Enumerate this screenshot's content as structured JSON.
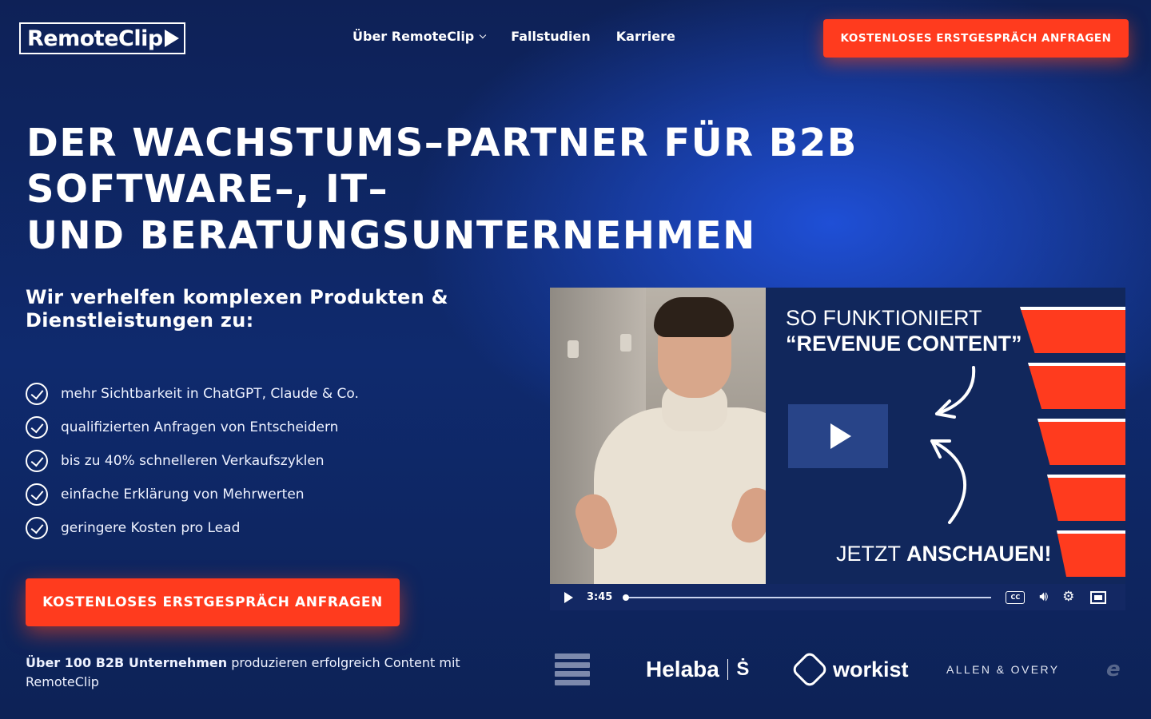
{
  "nav": {
    "logo_text": "RemoteClip",
    "links": [
      {
        "label": "Über RemoteClip",
        "has_dropdown": true
      },
      {
        "label": "Fallstudien"
      },
      {
        "label": "Karriere"
      }
    ],
    "cta_label": "KOSTENLOSES ERSTGESPRÄCH ANFRAGEN"
  },
  "hero": {
    "title_lines": [
      "DER WACHSTUMS–PARTNER FÜR B2B SOFTWARE–, IT–",
      "UND BERATUNGSUNTERNEHMEN"
    ],
    "subheadline": "Wir verhelfen komplexen Produkten & Dienstleistungen zu:",
    "bullets": [
      "mehr Sichtbarkeit in ChatGPT, Claude & Co.",
      "qualifizierten Anfragen von Entscheidern",
      "bis zu 40% schnelleren Verkaufszyklen",
      "einfache Erklärung von Mehrwerten",
      "geringere Kosten pro Lead"
    ],
    "cta_label": "KOSTENLOSES ERSTGESPRÄCH ANFRAGEN",
    "social_proof_bold": "Über 100 B2B Unternehmen",
    "social_proof_rest": " produzieren erfolgreich Content mit RemoteClip"
  },
  "video": {
    "title_line1": "SO FUNKTIONIERT",
    "title_line2": "“REVENUE CONTENT”",
    "cta_light": "JETZT ",
    "cta_bold": "ANSCHAUEN!",
    "duration": "3:45",
    "progress": 0,
    "cc_label": "CC",
    "accent_color": "#ff3b1e"
  },
  "logos": {
    "helaba": "Helaba",
    "helaba_mark": "Ṡ",
    "workist": "workist",
    "allen_overy": "ALLEN & OVERY",
    "partial": "e"
  },
  "colors": {
    "background": "#0f2a6e",
    "accent": "#ff3b1e",
    "text": "#ffffff"
  }
}
